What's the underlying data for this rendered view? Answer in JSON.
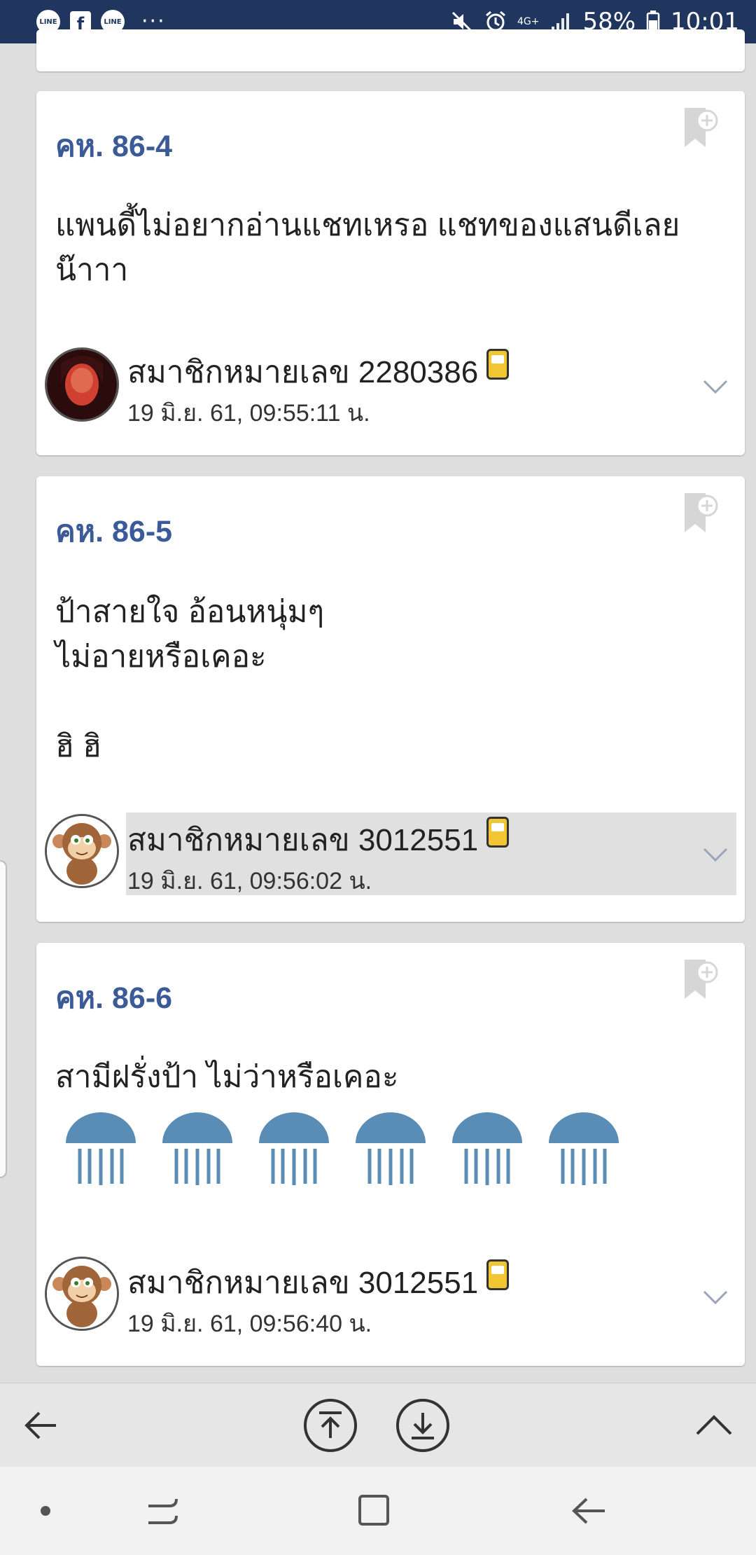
{
  "status_bar": {
    "apps": [
      "LINE",
      "LINE"
    ],
    "facebook": "f",
    "battery": "58%",
    "time": "10:01",
    "network": "4G+",
    "icons": [
      "mute-icon",
      "alarm-icon",
      "signal-icon",
      "battery-icon"
    ]
  },
  "posts": [
    {
      "number": "คห. 86-4",
      "body": "แพนดี้ไม่อยากอ่านแชทเหรอ แชทของแสนดีเลย\nน๊าาา",
      "member": "สมาชิกหมายเลข 2280386",
      "timestamp": "19 มิ.ย. 61, 09:55:11 น.",
      "avatar": "woman-avatar"
    },
    {
      "number": "คห. 86-5",
      "body": "ป้าสายใจ อ้อนหนุ่มๆ\nไม่อายหรือเคอะ\n\nฮิ ฮิ",
      "member": "สมาชิกหมายเลข 3012551",
      "timestamp": "19 มิ.ย. 61, 09:56:02 น.",
      "avatar": "monkey-avatar"
    },
    {
      "number": "คห. 86-6",
      "body": "สามีฝรั่งป้า ไม่ว่าหรือเคอะ",
      "member": "สมาชิกหมายเลข 3012551",
      "timestamp": "19 มิ.ย. 61, 09:56:40 น.",
      "avatar": "monkey-avatar",
      "emoji_count": 6
    }
  ],
  "colors": {
    "status_bar": "#20365f",
    "post_number": "#3a5a98",
    "background": "#dedede",
    "jelly": "#5a8db5"
  },
  "toolbar": {
    "icons": [
      "back-arrow-icon",
      "scroll-top-icon",
      "scroll-bottom-icon",
      "chevron-up-icon"
    ]
  },
  "navbar": {
    "icons": [
      "dot-icon",
      "recents-icon",
      "home-icon",
      "back-icon"
    ]
  }
}
